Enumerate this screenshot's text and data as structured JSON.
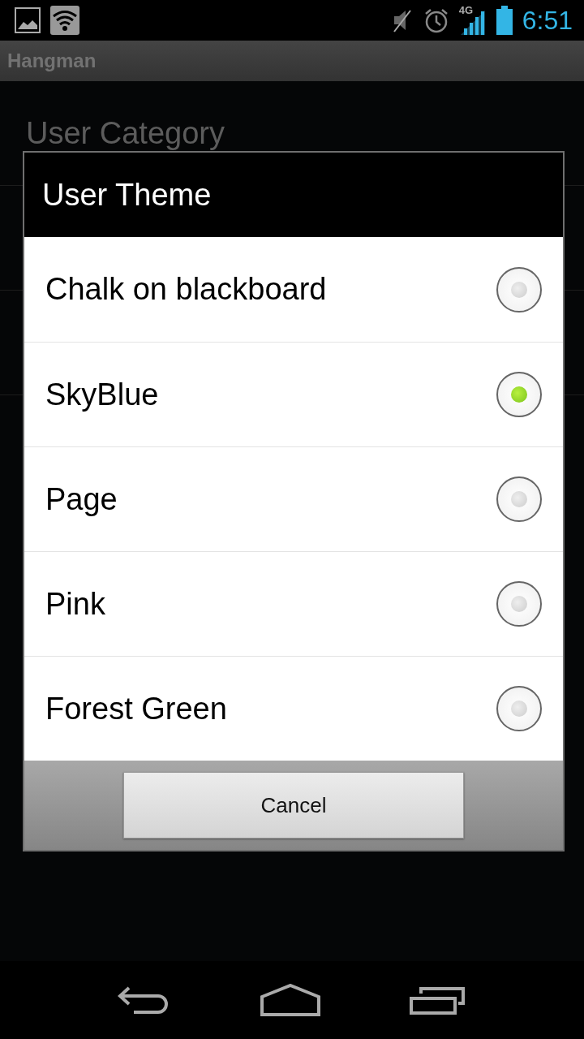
{
  "status_bar": {
    "time": "6:51",
    "network": "4G"
  },
  "action_bar": {
    "title": "Hangman"
  },
  "background_items": [
    {
      "title": "User Category"
    }
  ],
  "dialog": {
    "title": "User Theme",
    "options": [
      {
        "label": "Chalk on blackboard",
        "selected": false
      },
      {
        "label": "SkyBlue",
        "selected": true
      },
      {
        "label": "Page",
        "selected": false
      },
      {
        "label": "Pink",
        "selected": false
      },
      {
        "label": "Forest Green",
        "selected": false
      }
    ],
    "button": "Cancel"
  }
}
